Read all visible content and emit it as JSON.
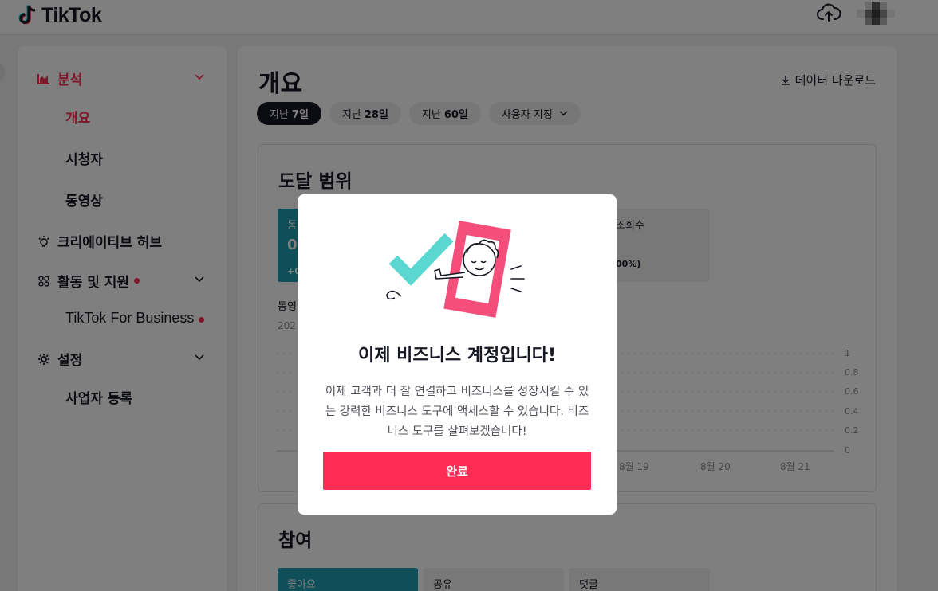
{
  "header": {
    "logo_text": "TikTok",
    "upload_icon": "cloud-upload-icon",
    "avatar": "avatar"
  },
  "sidebar": {
    "analytics": {
      "label": "분석",
      "icon": "chart-icon",
      "color": "#fe2c55"
    },
    "sub_items": [
      {
        "label": "개요",
        "active": true
      },
      {
        "label": "시청자"
      },
      {
        "label": "동영상"
      }
    ],
    "creative_hub": {
      "label": "크리에이티브 허브",
      "icon": "bulb-icon"
    },
    "activities": {
      "label": "활동 및 지원",
      "icon": "grid-icon",
      "badge": "red-dot"
    },
    "tiktok_for_business": {
      "label": "TikTok For Business",
      "badge": "red-dot"
    },
    "settings": {
      "label": "설정",
      "icon": "gear-icon"
    },
    "business_register": {
      "label": "사업자 등록"
    }
  },
  "main": {
    "title": "개요",
    "download_label": "데이터 다운로드",
    "tabs": [
      {
        "prefix": "지난",
        "bold": "7일",
        "selected": true
      },
      {
        "prefix": "지난",
        "bold": "28일"
      },
      {
        "prefix": "지난",
        "bold": "60일"
      },
      {
        "prefix": "사용자 지정",
        "bold": ""
      }
    ],
    "reach": {
      "title": "도달 범위",
      "metric_teal": {
        "label": "동",
        "value": "0",
        "change": "+0"
      },
      "metric_gray": {
        "label": "조회수",
        "change": "00%)"
      },
      "chart_label": "동영",
      "chart_date": "202",
      "y_ticks": [
        "1",
        "0.8",
        "0.6",
        "0.4",
        "0.2",
        "0"
      ],
      "x_ticks": [
        "8월 19",
        "8월 20",
        "8월 21"
      ]
    },
    "engagement": {
      "title": "참여",
      "metrics": [
        "좋아요",
        "공유",
        "댓글"
      ]
    }
  },
  "modal": {
    "title": "이제 비즈니스 계정입니다!",
    "body": "이제 고객과 더 잘 연결하고 비즈니스를 성장시킬 수 있는 강력한 비즈니스 도구에 액세스할 수 있습니다. 비즈니스 도구를 살펴보겠습니다!",
    "button": "완료",
    "colors": {
      "accent": "#fe2c55",
      "teal": "#5ad7d1",
      "pink": "#f44e7b"
    }
  }
}
